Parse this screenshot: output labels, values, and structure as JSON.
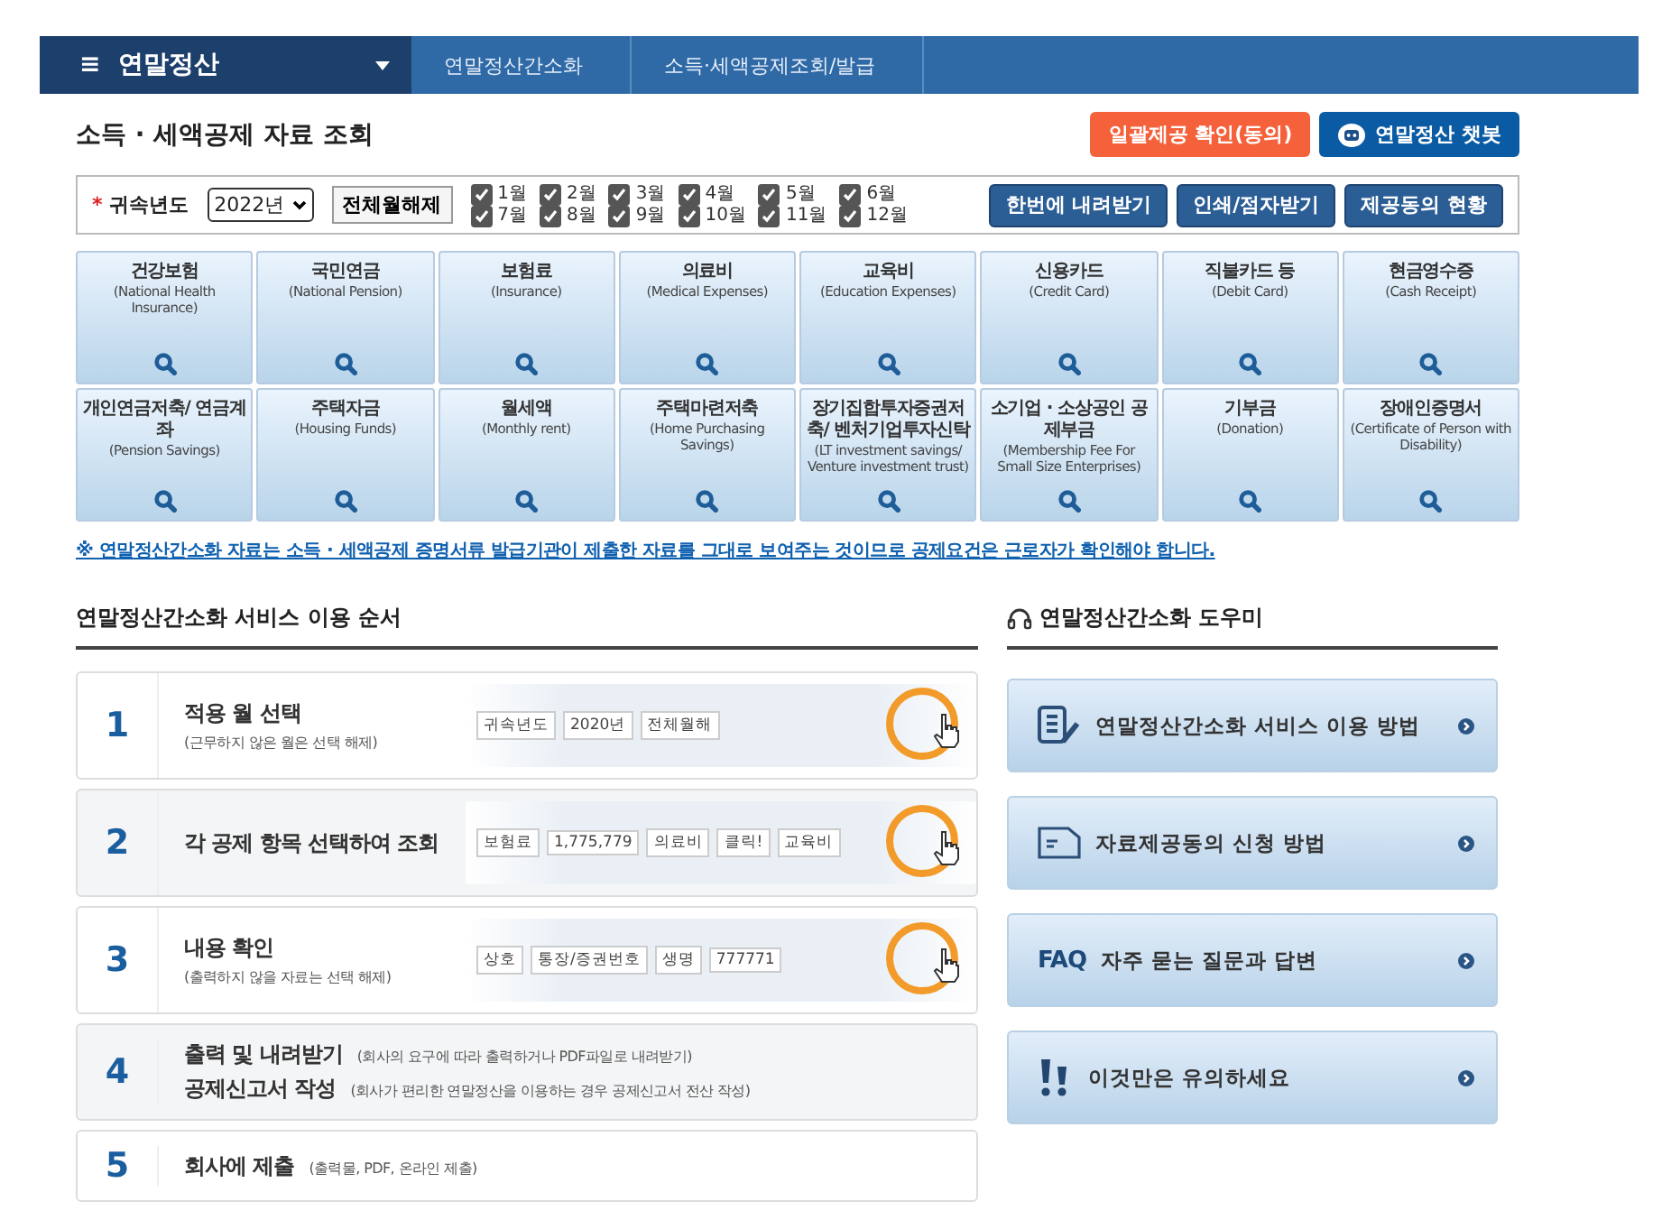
{
  "nav": {
    "menu_icon": "≡",
    "menu_label": "연말정산",
    "breadcrumbs": [
      "연말정산간소화",
      "소득·세액공제조회/발급"
    ]
  },
  "page_title": "소득 · 세액공제 자료 조회",
  "top_buttons": [
    {
      "kind": "consent",
      "label": "일괄제공 확인(동의)"
    },
    {
      "kind": "chatbot",
      "label": "연말정산 챗봇"
    }
  ],
  "filter": {
    "required_mark": "*",
    "year_label": "귀속년도",
    "year_value": "2022년",
    "toggle_all": "전체월해제",
    "months": [
      {
        "label": "1월",
        "checked": true
      },
      {
        "label": "7월",
        "checked": true
      },
      {
        "label": "2월",
        "checked": true
      },
      {
        "label": "8월",
        "checked": true
      },
      {
        "label": "3월",
        "checked": true
      },
      {
        "label": "9월",
        "checked": true
      },
      {
        "label": "4월",
        "checked": true
      },
      {
        "label": "10월",
        "checked": true
      },
      {
        "label": "5월",
        "checked": true
      },
      {
        "label": "11월",
        "checked": true
      },
      {
        "label": "6월",
        "checked": true
      },
      {
        "label": "12월",
        "checked": true
      }
    ],
    "actions": [
      "한번에 내려받기",
      "인쇄/점자받기",
      "제공동의 현황"
    ]
  },
  "categories": [
    {
      "title": "건강보험",
      "subtitle": "(National Health Insurance)"
    },
    {
      "title": "국민연금",
      "subtitle": "(National Pension)"
    },
    {
      "title": "보험료",
      "subtitle": "(Insurance)"
    },
    {
      "title": "의료비",
      "subtitle": "(Medical Expenses)"
    },
    {
      "title": "교육비",
      "subtitle": "(Education Expenses)"
    },
    {
      "title": "신용카드",
      "subtitle": "(Credit Card)"
    },
    {
      "title": "직불카드 등",
      "subtitle": "(Debit Card)"
    },
    {
      "title": "현금영수증",
      "subtitle": "(Cash Receipt)"
    },
    {
      "title": "개인연금저축/ 연금계좌",
      "subtitle": "(Pension Savings)"
    },
    {
      "title": "주택자금",
      "subtitle": "(Housing Funds)"
    },
    {
      "title": "월세액",
      "subtitle": "(Monthly rent)"
    },
    {
      "title": "주택마련저축",
      "subtitle": "(Home Purchasing Savings)"
    },
    {
      "title": "장기집합투자증권저축/ 벤처기업투자신탁",
      "subtitle": "(LT investment savings/ Venture investment trust)"
    },
    {
      "title": "소기업 · 소상공인 공제부금",
      "subtitle": "(Membership Fee For Small Size Enterprises)"
    },
    {
      "title": "기부금",
      "subtitle": "(Donation)"
    },
    {
      "title": "장애인증명서",
      "subtitle": "(Certificate of Person with Disability)"
    }
  ],
  "notice": "※ 연말정산간소화 자료는 소득 · 세액공제 증명서류 발급기관이 제출한 자료를 그대로 보여주는 것이므로 공제요건은 근로자가 확인해야 합니다.",
  "steps_title": "연말정산간소화 서비스 이용 순서",
  "steps": [
    {
      "number": "1",
      "lines": [
        {
          "title": "적용 월 선택",
          "desc": "(근무하지 않은 월은 선택 해제)"
        }
      ],
      "illustration": {
        "texts": [
          "귀속년도",
          "2020년",
          "전체월해"
        ]
      }
    },
    {
      "number": "2",
      "lines": [
        {
          "title": "각 공제 항목 선택하여 조회"
        }
      ],
      "illustration": {
        "texts": [
          "보험료",
          "1,775,779",
          "의료비",
          "클릭!",
          "교육비"
        ]
      }
    },
    {
      "number": "3",
      "lines": [
        {
          "title": "내용 확인",
          "desc": "(출력하지 않을 자료는 선택 해제)"
        }
      ],
      "illustration": {
        "texts": [
          "상호",
          "통장/증권번호",
          "생명",
          "777771"
        ]
      }
    },
    {
      "number": "4",
      "lines": [
        {
          "title": "출력 및 내려받기",
          "desc": "(회사의 요구에 따라 출력하거나 PDF파일로 내려받기)"
        },
        {
          "title": "공제신고서 작성",
          "desc": "(회사가 편리한 연말정산을 이용하는 경우 공제신고서 전산 작성)"
        }
      ]
    },
    {
      "number": "5",
      "lines": [
        {
          "title": "회사에 제출",
          "desc": "(출력물, PDF, 온라인 제출)"
        }
      ]
    }
  ],
  "help_title": "연말정산간소화 도우미",
  "help_items": [
    {
      "kind": "document",
      "label": "연말정산간소화 서비스 이용 방법"
    },
    {
      "kind": "form",
      "label": "자료제공동의 신청 방법"
    },
    {
      "kind": "faq",
      "badge": "FAQ",
      "label": "자주 묻는 질문과 답변"
    },
    {
      "kind": "caution",
      "label": "이것만은 유의하세요"
    }
  ]
}
